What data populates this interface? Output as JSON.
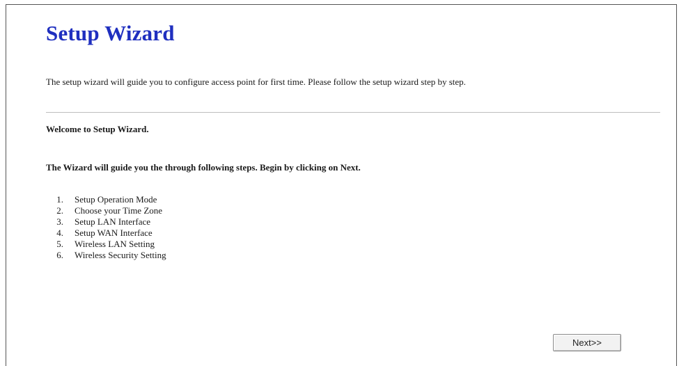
{
  "page": {
    "title": "Setup Wizard",
    "intro": "The setup wizard will guide you to configure access point for first time. Please follow the setup wizard step by step.",
    "welcome": "Welcome to Setup Wizard.",
    "guide": "The Wizard will guide you the through following steps. Begin by clicking on Next."
  },
  "steps": [
    {
      "number": "1.",
      "label": "Setup Operation Mode"
    },
    {
      "number": "2.",
      "label": "Choose your Time Zone"
    },
    {
      "number": "3.",
      "label": "Setup LAN Interface"
    },
    {
      "number": "4.",
      "label": "Setup WAN Interface"
    },
    {
      "number": "5.",
      "label": "Wireless LAN Setting"
    },
    {
      "number": "6.",
      "label": "Wireless Security Setting"
    }
  ],
  "buttons": {
    "next_label": "Next>>"
  },
  "colors": {
    "title": "#1f2fbf"
  }
}
